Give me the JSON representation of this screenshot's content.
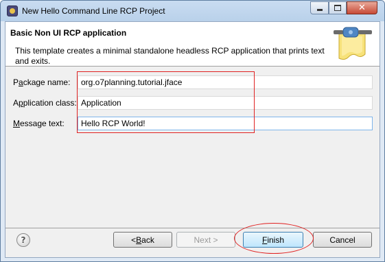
{
  "window": {
    "title": "New Hello Command Line RCP Project",
    "close_glyph": "✕"
  },
  "banner": {
    "title": "Basic Non UI RCP application",
    "description": "This template creates a minimal standalone headless RCP application that prints text and exits."
  },
  "form": {
    "package": {
      "label_prefix": "P",
      "label_mnemonic": "a",
      "label_suffix": "ckage name:",
      "value": "org.o7planning.tutorial.jface"
    },
    "application": {
      "label_prefix": "A",
      "label_mnemonic": "p",
      "label_suffix": "plication class:",
      "value": "Application"
    },
    "message": {
      "label_prefix": "",
      "label_mnemonic": "M",
      "label_suffix": "essage text:",
      "value": "Hello RCP World!"
    }
  },
  "buttons": {
    "help": "?",
    "back": {
      "prefix": "< ",
      "mnemonic": "B",
      "suffix": "ack"
    },
    "next": "Next >",
    "finish": {
      "prefix": "",
      "mnemonic": "F",
      "suffix": "inish"
    },
    "cancel": "Cancel"
  },
  "colors": {
    "annotation": "#e02020",
    "focused_border": "#7eb4ea",
    "default_button": "#3c7fb1"
  }
}
